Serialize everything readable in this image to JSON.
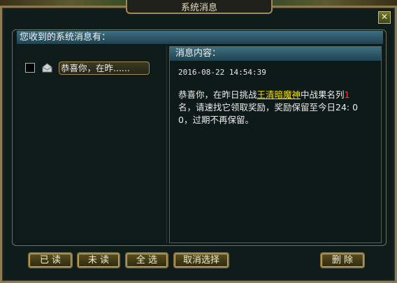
{
  "window": {
    "title": "系统消息",
    "close_symbol": "✕"
  },
  "list_header": "您收到的系统消息有：",
  "message_list": [
    {
      "preview": "恭喜你，在昨......",
      "selected": false
    }
  ],
  "detail": {
    "header": "消息内容：",
    "timestamp": "2016-08-22 14:54:39",
    "body_part1": "恭喜你，在昨日挑战",
    "highlight_name": "王清暗魔神",
    "body_part2": "中战果名列",
    "rank": "1",
    "body_part3": "名，请速找它领取奖励，奖励保留至今日24: 00，过期不再保留。"
  },
  "buttons": {
    "read": "已 读",
    "unread": "未 读",
    "select_all": "全 选",
    "deselect": "取消选择",
    "delete": "删 除"
  },
  "colors": {
    "highlight": "#f5e000",
    "rank": "#ff3b2e",
    "header_bg": "#2f5a68",
    "button_bg": "#4a4118"
  },
  "icons": {
    "envelope": "mail-open-icon",
    "close": "close-icon"
  }
}
